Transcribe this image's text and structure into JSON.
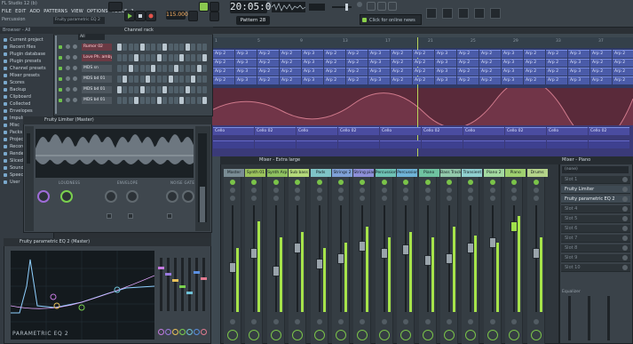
{
  "window": {
    "title": "FL Studio 12 (b)",
    "song_name": "Percussion"
  },
  "menu": [
    "FILE",
    "EDIT",
    "ADD",
    "PATTERNS",
    "VIEW",
    "OPTIONS",
    "TOOLS",
    "?"
  ],
  "toolbar": {
    "hint_text": "Fruity parametric EQ 2",
    "tempo": "115.000",
    "clock": "20:05:09",
    "pattern": "Pattern 28",
    "online_news": "Click for online news"
  },
  "browser": {
    "header": "Browser - All",
    "items": [
      "Current project",
      "Recent files",
      "Plugin database",
      "Plugin presets",
      "Channel presets",
      "Mixer presets",
      "Scores",
      "Backup",
      "Clipboard",
      "Collected",
      "Envelopes",
      "Impulses",
      "Misc",
      "Packs",
      "Projects",
      "Recorded",
      "Rendered",
      "Sliced",
      "Soundfonts",
      "Speech",
      "User"
    ]
  },
  "channel_rack": {
    "title": "Channel rack",
    "filter": "All",
    "channels": [
      {
        "name": "Rumor 02",
        "red": true
      },
      {
        "name": "Love Ph. amby",
        "red": true
      },
      {
        "name": "MDS sn",
        "red": false
      },
      {
        "name": "MDS bd 01",
        "red": false
      },
      {
        "name": "MDS bd 01",
        "red": false
      },
      {
        "name": "MDS bd 01",
        "red": false
      }
    ]
  },
  "limiter": {
    "title": "Fruity Limiter (Master)",
    "sections": [
      "LOUDNESS",
      "ENVELOPE",
      "NOISE GATE"
    ]
  },
  "eq": {
    "title": "Fruity parametric EQ 2 (Master)",
    "logo": "PARAMETRIC EQ 2"
  },
  "playlist": {
    "timeline": [
      "1",
      "5",
      "9",
      "13",
      "17",
      "21",
      "25",
      "29",
      "33",
      "37"
    ],
    "arp_clip": "Arp 2",
    "arp_clip_alt": "Arp 3",
    "cello_clip": "Cello",
    "cello_clip_alt": "Cello 02"
  },
  "mixer": {
    "title": "Mixer - Extra large",
    "tracks": [
      {
        "name": "Master",
        "color": "#7a8c94"
      },
      {
        "name": "Synth 01",
        "color": "#9bc25c"
      },
      {
        "name": "Synth Arp",
        "color": "#8fc160"
      },
      {
        "name": "Sub bass",
        "color": "#b4d97a"
      },
      {
        "name": "Pads",
        "color": "#7fc3c6"
      },
      {
        "name": "Strings 2",
        "color": "#7fa0d6"
      },
      {
        "name": "String piano",
        "color": "#8d8fd8"
      },
      {
        "name": "Percussion",
        "color": "#6ec2b5"
      },
      {
        "name": "Percussion 2",
        "color": "#6fb3d6"
      },
      {
        "name": "Piano",
        "color": "#6fc2a0"
      },
      {
        "name": "Bass Track",
        "color": "#92c8ab"
      },
      {
        "name": "Transient",
        "color": "#90cfcf"
      },
      {
        "name": "Piano 2",
        "color": "#a3d9a0"
      },
      {
        "name": "Piano",
        "color": "#9fd06f"
      },
      {
        "name": "Drums",
        "color": "#b5d48a"
      }
    ],
    "fader_levels": [
      0.42,
      0.55,
      0.38,
      0.6,
      0.45,
      0.5,
      0.62,
      0.55,
      0.58,
      0.48,
      0.5,
      0.6,
      0.65,
      0.8,
      0.55
    ],
    "meter_levels": [
      0.6,
      0.85,
      0.7,
      0.75,
      0.6,
      0.65,
      0.8,
      0.7,
      0.75,
      0.7,
      0.8,
      0.72,
      0.65,
      0.9,
      0.7
    ]
  },
  "mixer_side": {
    "title": "Mixer - Piano",
    "insert": "(none)",
    "slots": [
      "Slot 1",
      "Fruity Limiter",
      "Fruity parametric EQ 2",
      "Slot 4",
      "Slot 5",
      "Slot 6",
      "Slot 7",
      "Slot 8",
      "Slot 9",
      "Slot 10"
    ],
    "equalizer_label": "Equalizer"
  }
}
